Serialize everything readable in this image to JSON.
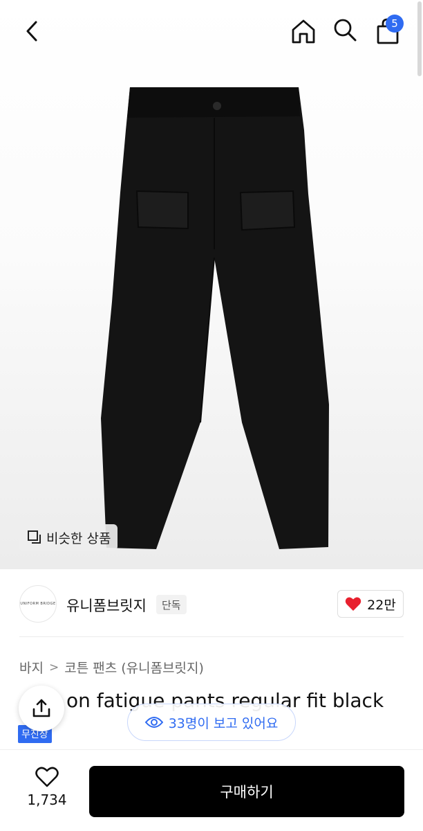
{
  "header": {
    "back_icon": "chevron-left-icon",
    "home_icon": "home-icon",
    "search_icon": "search-icon",
    "cart_icon": "shopping-bag-icon",
    "cart_count": "5"
  },
  "hero": {
    "similar_products_label": "비슷한 상품"
  },
  "brand": {
    "logo_text": "UNIFORM BRIDGE",
    "name": "유니폼브릿지",
    "tag": "단독",
    "like_count": "22만"
  },
  "breadcrumb": {
    "category": "바지",
    "subcategory": "코튼 팬츠 (유니폼브릿지)"
  },
  "product": {
    "title_visible": "on fatigue pants regular fit black",
    "badge": "무진장"
  },
  "viewers": {
    "text": "33명이 보고 있어요"
  },
  "bottom": {
    "wish_count": "1,734",
    "buy_label": "구매하기"
  },
  "colors": {
    "accent": "#2f6bf1",
    "like_heart": "#e8202e",
    "buy_button": "#000000"
  }
}
